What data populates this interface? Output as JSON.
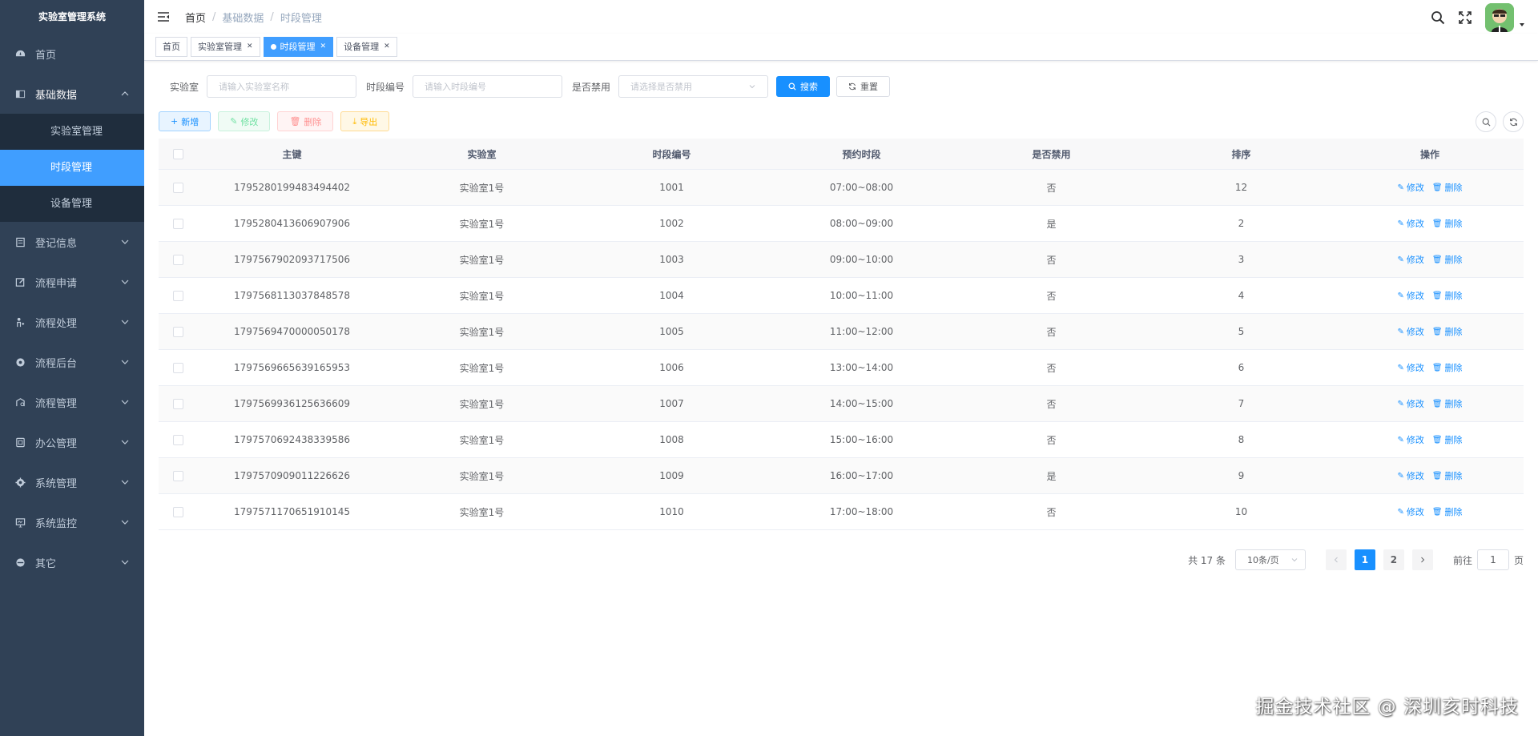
{
  "sidebar": {
    "logo": "实验室管理系统",
    "items": [
      {
        "label": "首页",
        "icon": "dashboard-icon"
      },
      {
        "label": "基础数据",
        "icon": "database-icon",
        "expanded": true,
        "children": [
          {
            "label": "实验室管理"
          },
          {
            "label": "时段管理",
            "active": true
          },
          {
            "label": "设备管理"
          }
        ]
      },
      {
        "label": "登记信息",
        "icon": "register-icon"
      },
      {
        "label": "流程申请",
        "icon": "edit-icon"
      },
      {
        "label": "流程处理",
        "icon": "process-icon"
      },
      {
        "label": "流程后台",
        "icon": "settings-icon"
      },
      {
        "label": "流程管理",
        "icon": "manage-icon"
      },
      {
        "label": "办公管理",
        "icon": "office-icon"
      },
      {
        "label": "系统管理",
        "icon": "system-icon"
      },
      {
        "label": "系统监控",
        "icon": "monitor-icon"
      },
      {
        "label": "其它",
        "icon": "other-icon"
      }
    ]
  },
  "header": {
    "breadcrumb": [
      "首页",
      "基础数据",
      "时段管理"
    ]
  },
  "tags": [
    {
      "label": "首页",
      "closable": false,
      "active": false
    },
    {
      "label": "实验室管理",
      "closable": true,
      "active": false
    },
    {
      "label": "时段管理",
      "closable": true,
      "active": true
    },
    {
      "label": "设备管理",
      "closable": true,
      "active": false
    }
  ],
  "search": {
    "lab_label": "实验室",
    "lab_placeholder": "请输入实验室名称",
    "code_label": "时段编号",
    "code_placeholder": "请输入时段编号",
    "disabled_label": "是否禁用",
    "disabled_placeholder": "请选择是否禁用",
    "search_btn": "搜索",
    "reset_btn": "重置"
  },
  "toolbar": {
    "add": "新增",
    "edit": "修改",
    "delete": "删除",
    "export": "导出"
  },
  "table": {
    "headers": [
      "主键",
      "实验室",
      "时段编号",
      "预约时段",
      "是否禁用",
      "排序",
      "操作"
    ],
    "op_edit": "修改",
    "op_delete": "删除",
    "rows": [
      [
        "1795280199483494402",
        "实验室1号",
        "1001",
        "07:00~08:00",
        "否",
        "12"
      ],
      [
        "1795280413606907906",
        "实验室1号",
        "1002",
        "08:00~09:00",
        "是",
        "2"
      ],
      [
        "1797567902093717506",
        "实验室1号",
        "1003",
        "09:00~10:00",
        "否",
        "3"
      ],
      [
        "1797568113037848578",
        "实验室1号",
        "1004",
        "10:00~11:00",
        "否",
        "4"
      ],
      [
        "1797569470000050178",
        "实验室1号",
        "1005",
        "11:00~12:00",
        "否",
        "5"
      ],
      [
        "1797569665639165953",
        "实验室1号",
        "1006",
        "13:00~14:00",
        "否",
        "6"
      ],
      [
        "1797569936125636609",
        "实验室1号",
        "1007",
        "14:00~15:00",
        "否",
        "7"
      ],
      [
        "1797570692438339586",
        "实验室1号",
        "1008",
        "15:00~16:00",
        "否",
        "8"
      ],
      [
        "1797570909011226626",
        "实验室1号",
        "1009",
        "16:00~17:00",
        "是",
        "9"
      ],
      [
        "1797571170651910145",
        "实验室1号",
        "1010",
        "17:00~18:00",
        "否",
        "10"
      ]
    ]
  },
  "pagination": {
    "total": "共 17 条",
    "page_size": "10条/页",
    "pages": [
      "1",
      "2"
    ],
    "current": "1",
    "goto_label": "前往",
    "goto_value": "1",
    "page_unit": "页"
  },
  "watermark": "掘金技术社区 @ 深圳亥时科技",
  "colors": {
    "sidebar_bg": "#304156",
    "submenu_bg": "#1f2d3d",
    "primary": "#1890ff",
    "active_menu": "#409eff"
  }
}
